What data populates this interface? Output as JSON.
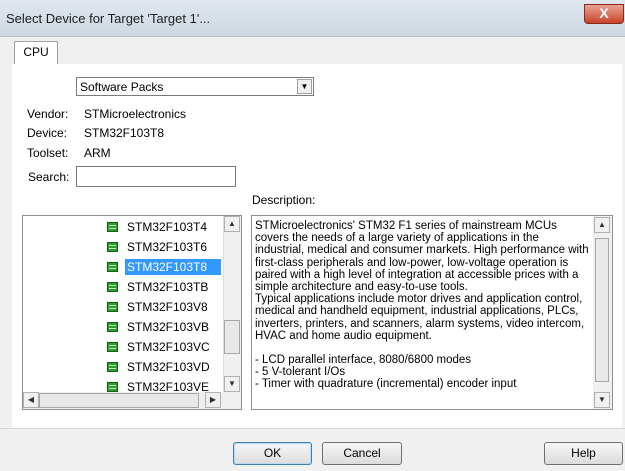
{
  "window": {
    "title": "Select Device for Target 'Target 1'...",
    "close_glyph": "X"
  },
  "tabs": [
    {
      "label": "CPU"
    }
  ],
  "source_select": {
    "selected": "Software Packs"
  },
  "details": {
    "vendor_label": "Vendor:",
    "vendor_value": "STMicroelectronics",
    "device_label": "Device:",
    "device_value": "STM32F103T8",
    "toolset_label": "Toolset:",
    "toolset_value": "ARM",
    "search_label": "Search:",
    "search_value": ""
  },
  "description_label": "Description:",
  "device_list": {
    "items": [
      "STM32F103T4",
      "STM32F103T6",
      "STM32F103T8",
      "STM32F103TB",
      "STM32F103V8",
      "STM32F103VB",
      "STM32F103VC",
      "STM32F103VD",
      "STM32F103VE"
    ],
    "selected": "STM32F103T8"
  },
  "description": {
    "paragraph1": "STMicroelectronics' STM32 F1 series of mainstream MCUs covers the needs of a large variety of applications in the industrial, medical and consumer markets. High performance with first-class peripherals and low-power, low-voltage operation is paired with a high level of integration at accessible prices with a simple architecture and easy-to-use tools.",
    "paragraph2": "Typical applications include motor drives and application control, medical and handheld equipment, industrial applications, PLCs, inverters, printers, and scanners, alarm systems, video intercom, HVAC and home audio equipment.",
    "bullets": [
      "- LCD parallel interface, 8080/6800 modes",
      "- 5 V-tolerant I/Os",
      "- Timer with quadrature (incremental) encoder input"
    ]
  },
  "buttons": {
    "ok": "OK",
    "cancel": "Cancel",
    "help": "Help"
  },
  "colors": {
    "selection": "#3399ff",
    "chip": "#2a9d2a"
  }
}
